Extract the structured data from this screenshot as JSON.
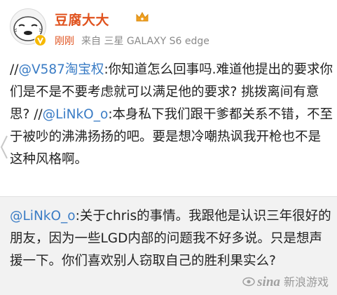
{
  "post": {
    "username": "豆腐大大",
    "time": "刚刚",
    "source_prefix": "来自",
    "source_device": "三星 GALAXY S6 edge",
    "content": {
      "prefix1": "//",
      "mention1": "@V587淘宝权",
      "text1": ":你知道怎么回事吗.难道他提出的要求你们是不是不要考虑就可以满足他的要求? 挑拨离间有意思? //",
      "mention2": "@LiNkO_o",
      "text2": ":本身私下我们跟干爹都关系不错，不至于被吵的沸沸扬扬的吧。要是想冷嘲热讽我开枪也不是这种风格啊。"
    }
  },
  "quote": {
    "mention": "@LiNkO_o",
    "text": ":关于chris的事情。我跟他是认识三年很好的朋友，因为一些LGD内部的问题我不好多说。只是想声援一下。你们喜欢别人窃取自己的胜利果实么?"
  },
  "watermark": {
    "brand": "sina",
    "label": "新浪游戏"
  },
  "colors": {
    "username": "#e0531f",
    "mention": "#3a7cc5",
    "quote_bg": "#f2f2f2",
    "badge": "#f6b800"
  },
  "icons": {
    "avatar": "cartoon-face-avatar",
    "verified": "verified-v-badge-icon",
    "member": "crown-icon",
    "nav": "chevron-left-icon"
  }
}
